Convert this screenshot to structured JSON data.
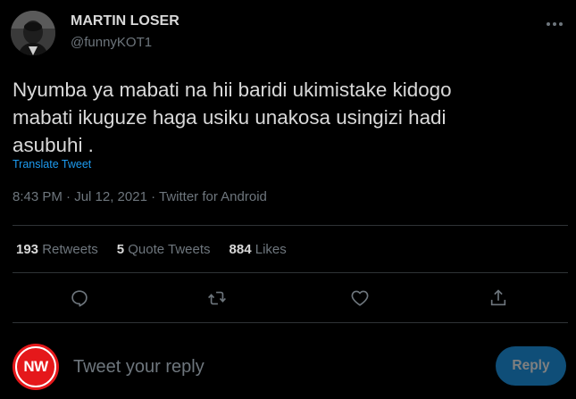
{
  "author": {
    "display_name": "MARTIN LOSER",
    "handle": "@funnyKOT1",
    "avatar_icon": "user-avatar"
  },
  "tweet": {
    "text": "Nyumba ya mabati na hii baridi ukimistake kidogo\nmabati ikuguze haga usiku unakosa usingizi hadi\nasubuhi .",
    "translate_label": "Translate Tweet",
    "meta": "8:43 PM · Jul 12, 2021 · Twitter for Android"
  },
  "stats": {
    "retweets": {
      "count": "193",
      "label": "Retweets"
    },
    "quote_tweets": {
      "count": "5",
      "label": "Quote Tweets"
    },
    "likes": {
      "count": "884",
      "label": "Likes"
    }
  },
  "actions": [
    {
      "name": "reply",
      "icon": "comment-icon"
    },
    {
      "name": "retweet",
      "icon": "retweet-icon"
    },
    {
      "name": "like",
      "icon": "heart-icon"
    },
    {
      "name": "share",
      "icon": "share-icon"
    }
  ],
  "reply_box": {
    "avatar_text": "NW",
    "placeholder": "Tweet your reply",
    "button_label": "Reply"
  },
  "colors": {
    "background": "#000000",
    "text": "#d9d9d9",
    "secondary_text": "#6e767d",
    "link": "#1d9bf0",
    "divider": "#2f3336",
    "reply_button": "#0f4e78",
    "nw_red": "#e5181b"
  }
}
